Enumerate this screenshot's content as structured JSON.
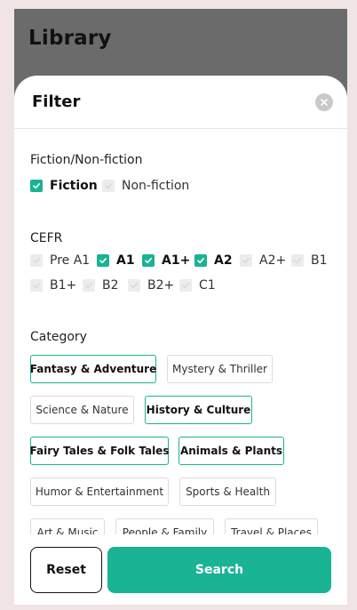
{
  "app": {
    "title": "Library"
  },
  "filter": {
    "title": "Filter",
    "sections": {
      "fiction": {
        "title": "Fiction/Non-fiction",
        "options": [
          {
            "label": "Fiction",
            "checked": true
          },
          {
            "label": "Non-fiction",
            "checked": false
          }
        ]
      },
      "cefr": {
        "title": "CEFR",
        "options": [
          {
            "label": "Pre A1",
            "checked": false
          },
          {
            "label": "A1",
            "checked": true
          },
          {
            "label": "A1+",
            "checked": true
          },
          {
            "label": "A2",
            "checked": true
          },
          {
            "label": "A2+",
            "checked": false
          },
          {
            "label": "B1",
            "checked": false
          },
          {
            "label": "B1+",
            "checked": false
          },
          {
            "label": "B2",
            "checked": false
          },
          {
            "label": "B2+",
            "checked": false
          },
          {
            "label": "C1",
            "checked": false
          }
        ]
      },
      "category": {
        "title": "Category",
        "chips": [
          {
            "label": "Fantasy & Adventure",
            "selected": true
          },
          {
            "label": "Mystery & Thriller",
            "selected": false
          },
          {
            "label": "Science & Nature",
            "selected": false
          },
          {
            "label": "History & Culture",
            "selected": true
          },
          {
            "label": "Fairy Tales & Folk Tales",
            "selected": true
          },
          {
            "label": "Animals & Plants",
            "selected": true
          },
          {
            "label": "Humor & Entertainment",
            "selected": false
          },
          {
            "label": "Sports & Health",
            "selected": false
          },
          {
            "label": "Art & Music",
            "selected": false
          },
          {
            "label": "People & Family",
            "selected": false
          },
          {
            "label": "Travel & Places",
            "selected": false
          }
        ]
      }
    },
    "buttons": {
      "reset": "Reset",
      "search": "Search"
    }
  },
  "colors": {
    "accent": "#1ab394",
    "backdrop": "#6b6b6b",
    "page_bg": "#f1e4e4"
  },
  "icons": {
    "close": "close-icon",
    "check": "check-icon"
  }
}
